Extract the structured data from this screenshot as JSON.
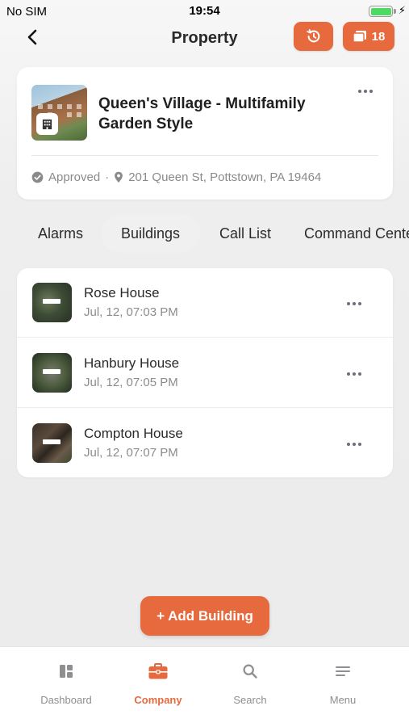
{
  "status_bar": {
    "carrier": "No SIM",
    "time": "19:54",
    "battery_level": 1.0
  },
  "header": {
    "title": "Property",
    "files_count": "18"
  },
  "property": {
    "name": "Queen's Village - Multifamily Garden Style",
    "status": "Approved",
    "separator": "·",
    "address": "201 Queen St, Pottstown, PA 19464"
  },
  "tabs": [
    {
      "label": "Alarms"
    },
    {
      "label": "Buildings",
      "active": true
    },
    {
      "label": "Call List"
    },
    {
      "label": "Command Center"
    }
  ],
  "buildings": [
    {
      "name": "Rose House",
      "date": "Jul, 12, 07:03 PM"
    },
    {
      "name": "Hanbury House",
      "date": "Jul, 12, 07:05 PM"
    },
    {
      "name": "Compton House",
      "date": "Jul, 12, 07:07 PM"
    }
  ],
  "add_button": {
    "label": "+ Add Building"
  },
  "nav": [
    {
      "label": "Dashboard",
      "icon": "dashboard-icon"
    },
    {
      "label": "Company",
      "icon": "briefcase-icon",
      "active": true
    },
    {
      "label": "Search",
      "icon": "search-icon"
    },
    {
      "label": "Menu",
      "icon": "menu-icon"
    }
  ],
  "colors": {
    "accent": "#e66a3d",
    "battery": "#4cd964",
    "inactive": "#8e8e93"
  }
}
